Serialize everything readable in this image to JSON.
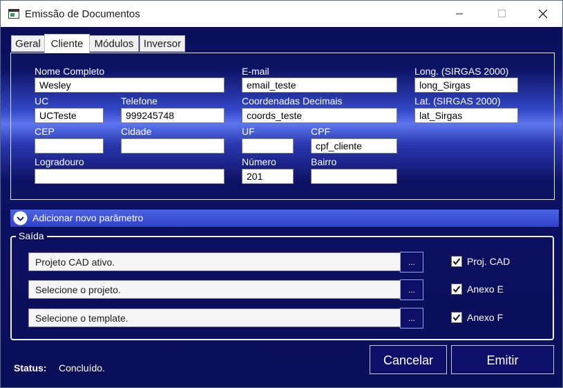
{
  "window": {
    "title": "Emissão de Documentos"
  },
  "tabs": [
    {
      "label": "Geral",
      "active": false
    },
    {
      "label": "Cliente",
      "active": true
    },
    {
      "label": "Módulos",
      "active": false
    },
    {
      "label": "Inversor",
      "active": false
    }
  ],
  "cliente": {
    "nome_label": "Nome Completo",
    "nome_value": "Wesley",
    "email_label": "E-mail",
    "email_value": "email_teste",
    "long_label": "Long. (SIRGAS 2000)",
    "long_value": "long_Sirgas",
    "uc_label": "UC",
    "uc_value": "UCTeste",
    "telefone_label": "Telefone",
    "telefone_value": "999245748",
    "coords_label": "Coordenadas Decimais",
    "coords_value": "coords_teste",
    "lat_label": "Lat.  (SIRGAS 2000)",
    "lat_value": "lat_Sirgas",
    "cep_label": "CEP",
    "cep_value": "",
    "cidade_label": "Cidade",
    "cidade_value": "",
    "uf_label": "UF",
    "uf_value": "",
    "cpf_label": "CPF",
    "cpf_value": "cpf_cliente",
    "logradouro_label": "Logradouro",
    "logradouro_value": "",
    "numero_label": "Número",
    "numero_value": "201",
    "bairro_label": "Bairro",
    "bairro_value": ""
  },
  "expander": {
    "label": "Adicionar novo parâmetro",
    "icon": "chevron-down-circle-icon"
  },
  "saida": {
    "title": "Saída",
    "rows": [
      {
        "path": "Projeto CAD ativo.",
        "browse": "...",
        "check_label": "Proj. CAD",
        "checked": true
      },
      {
        "path": "Selecione o projeto.",
        "browse": "...",
        "check_label": "Anexo E",
        "checked": true
      },
      {
        "path": "Selecione o template.",
        "browse": "...",
        "check_label": "Anexo F",
        "checked": true
      }
    ]
  },
  "status": {
    "label": "Status:",
    "value": "Concluído."
  },
  "buttons": {
    "cancelar": "Cancelar",
    "emitir": "Emitir"
  },
  "colors": {
    "window_bg": "#0b0e5a",
    "accent": "#3042c8",
    "button_bg": "#0d0f68"
  }
}
